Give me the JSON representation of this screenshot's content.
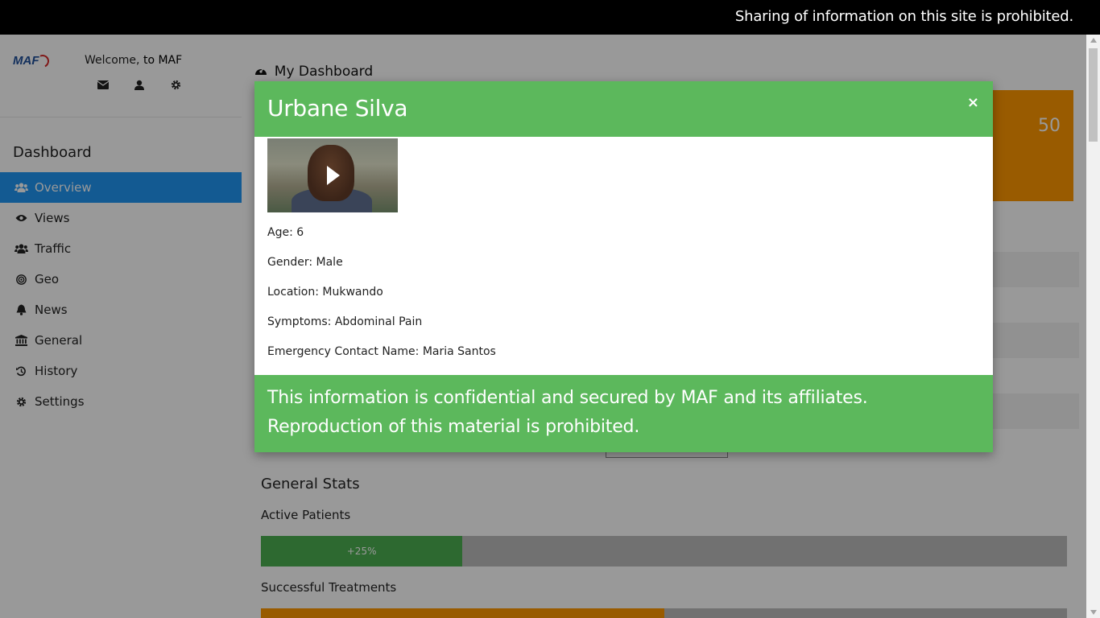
{
  "topbar": {
    "notice": "Sharing of information on this site is prohibited."
  },
  "sidebar": {
    "logo_text": "MAF",
    "welcome_prefix": "Welcome,",
    "welcome_suffix": "to MAF",
    "icons": [
      "envelope-icon",
      "user-icon",
      "gear-icon"
    ],
    "section_title": "Dashboard",
    "items": [
      {
        "label": "Overview",
        "icon": "users-icon",
        "active": true
      },
      {
        "label": "Views",
        "icon": "eye-icon"
      },
      {
        "label": "Traffic",
        "icon": "users-icon"
      },
      {
        "label": "Geo",
        "icon": "bullseye-icon"
      },
      {
        "label": "News",
        "icon": "bell-icon"
      },
      {
        "label": "General",
        "icon": "bank-icon"
      },
      {
        "label": "History",
        "icon": "history-icon"
      },
      {
        "label": "Settings",
        "icon": "gear-icon"
      }
    ]
  },
  "main": {
    "title": "My Dashboard",
    "card_value": "50",
    "stats_title": "General Stats",
    "stats": [
      {
        "label": "Active Patients",
        "value_label": "+25%",
        "percent": 25,
        "color": "#4caf50"
      },
      {
        "label": "Successful Treatments",
        "value_label": "",
        "percent": 50,
        "color": "#ff9800"
      }
    ]
  },
  "modal": {
    "name": "Urbane Silva",
    "close_symbol": "×",
    "fields": [
      {
        "label": "Age:",
        "value": "6"
      },
      {
        "label": "Gender:",
        "value": "Male"
      },
      {
        "label": "Location:",
        "value": "Mukwando"
      },
      {
        "label": "Symptoms:",
        "value": "Abdominal Pain"
      },
      {
        "label": "Emergency Contact Name:",
        "value": "Maria Santos"
      }
    ],
    "footer_lines": [
      "This information is confidential and secured by MAF and its affiliates.",
      "Reproduction of this material is prohibited."
    ]
  },
  "colors": {
    "accent": "#2196F3",
    "modal_green": "#5cb85c",
    "orange": "#ff9800"
  }
}
